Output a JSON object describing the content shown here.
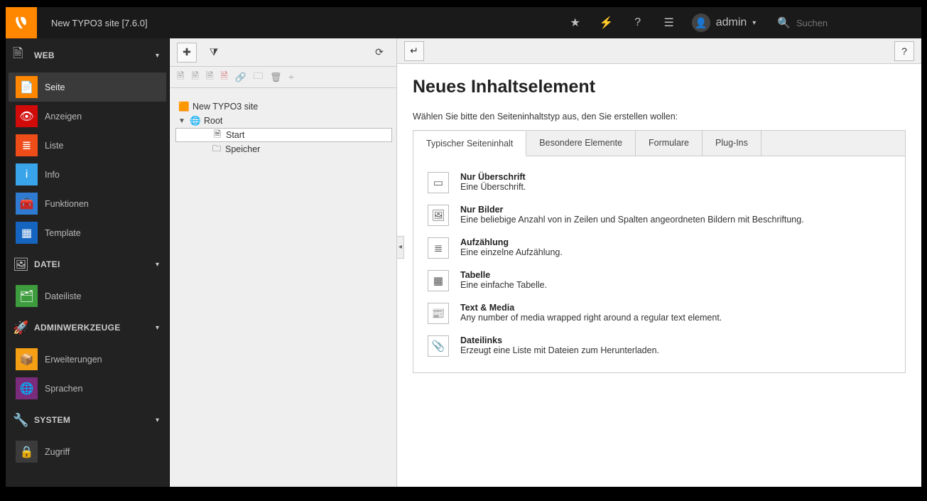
{
  "header": {
    "site_label": "New TYPO3 site [7.6.0]",
    "user_label": "admin",
    "search_placeholder": "Suchen"
  },
  "module_menu": {
    "groups": [
      {
        "id": "web",
        "title": "WEB",
        "icon": "page",
        "items": [
          {
            "id": "page",
            "label": "Seite",
            "icon": "c-page",
            "glyph": "📄",
            "active": true
          },
          {
            "id": "view",
            "label": "Anzeigen",
            "icon": "c-view",
            "glyph": "👁"
          },
          {
            "id": "list",
            "label": "Liste",
            "icon": "c-list",
            "glyph": "≣"
          },
          {
            "id": "info",
            "label": "Info",
            "icon": "c-info",
            "glyph": "i"
          },
          {
            "id": "func",
            "label": "Funktionen",
            "icon": "c-func",
            "glyph": "🧰"
          },
          {
            "id": "tmpl",
            "label": "Template",
            "icon": "c-tmpl",
            "glyph": "▦"
          }
        ]
      },
      {
        "id": "file",
        "title": "DATEI",
        "icon": "image",
        "items": [
          {
            "id": "filelist",
            "label": "Dateiliste",
            "icon": "c-file",
            "glyph": "🗂"
          }
        ]
      },
      {
        "id": "admin",
        "title": "ADMINWERKZEUGE",
        "icon": "rocket",
        "items": [
          {
            "id": "ext",
            "label": "Erweiterungen",
            "icon": "c-ext",
            "glyph": "📦"
          },
          {
            "id": "lang",
            "label": "Sprachen",
            "icon": "c-lang",
            "glyph": "🌐"
          }
        ]
      },
      {
        "id": "system",
        "title": "SYSTEM",
        "icon": "wrench",
        "items": [
          {
            "id": "access",
            "label": "Zugriff",
            "icon": "c-acc",
            "glyph": "🔒"
          }
        ]
      }
    ],
    "group_glyph": {
      "web": "🗎",
      "file": "🖼",
      "admin": "🚀",
      "system": "🔧"
    }
  },
  "pagetree": {
    "root_label": "New TYPO3 site",
    "nodes": [
      {
        "label": "Root",
        "expanded": true,
        "children": [
          {
            "label": "Start",
            "selected": true,
            "glyph": "🗎"
          },
          {
            "label": "Speicher",
            "glyph": "🗀"
          }
        ]
      }
    ]
  },
  "content": {
    "heading": "Neues Inhaltselement",
    "lead": "Wählen Sie bitte den Seiteninhaltstyp aus, den Sie erstellen wollen:",
    "tabs": [
      {
        "label": "Typischer Seiteninhalt",
        "active": true
      },
      {
        "label": "Besondere Elemente"
      },
      {
        "label": "Formulare"
      },
      {
        "label": "Plug-Ins"
      }
    ],
    "wizard_items": [
      {
        "title": "Nur Überschrift",
        "desc": "Eine Überschrift.",
        "glyph": "▭"
      },
      {
        "title": "Nur Bilder",
        "desc": "Eine beliebige Anzahl von in Zeilen und Spalten angeordneten Bildern mit Beschriftung.",
        "glyph": "🖼"
      },
      {
        "title": "Aufzählung",
        "desc": "Eine einzelne Aufzählung.",
        "glyph": "≣"
      },
      {
        "title": "Tabelle",
        "desc": "Eine einfache Tabelle.",
        "glyph": "▦"
      },
      {
        "title": "Text & Media",
        "desc": "Any number of media wrapped right around a regular text element.",
        "glyph": "📰"
      },
      {
        "title": "Dateilinks",
        "desc": "Erzeugt eine Liste mit Dateien zum Herunterladen.",
        "glyph": "📎"
      }
    ]
  }
}
